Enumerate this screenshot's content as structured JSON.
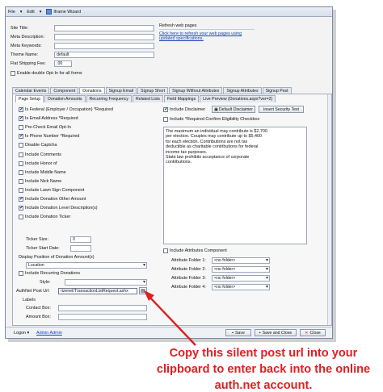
{
  "menu": {
    "file": "File",
    "edit": "Edit",
    "wizard": "Iframe Wizard"
  },
  "site": {
    "site_title_label": "Site Title:",
    "meta_description_label": "Meta Description:",
    "meta_keywords_label": "Meta Keywords:",
    "theme_name_label": "Theme Name:",
    "theme_name_value": "default",
    "flat_shipping_label": "Flat Shipping Fee:",
    "flat_shipping_value": ".00",
    "double_optin_label": "Enable double Opt-In for all forms"
  },
  "refresh": {
    "title": "Refresh web pages",
    "link_line1": "Click here to refresh your web pages using",
    "link_line2": "updated specifications."
  },
  "tabs": [
    "Calendar Events",
    "Component",
    "Donations",
    "Signup Email",
    "Signup Short",
    "Signup Without Attributes",
    "Signup Attributes",
    "Signup Post"
  ],
  "subtabs": [
    "Page Setup",
    "Donation Amounts",
    "Recurring Frequency",
    "Related Lists",
    "Field Mappings",
    "Live Preview (Donations.aspx?ver=2)"
  ],
  "left_options": [
    {
      "label": "Is Federal (Employer / Occupation) *Required",
      "checked": true
    },
    {
      "label": "Is Email Address *Required",
      "checked": true
    },
    {
      "label": "Pre-Check Email Opt-In",
      "checked": false
    },
    {
      "label": "Is Phone Number *Required",
      "checked": true
    },
    {
      "label": "Disable Captcha",
      "checked": false
    },
    {
      "label": "Include Comments",
      "checked": false
    },
    {
      "label": "Include Honor of",
      "checked": false
    },
    {
      "label": "Include Middle Name",
      "checked": false
    },
    {
      "label": "Include Nick Name",
      "checked": false
    },
    {
      "label": "Include Lawn Sign Component",
      "checked": false
    },
    {
      "label": "Include Donation Other Amount",
      "checked": true
    },
    {
      "label": "Include Donation Level Description(s)",
      "checked": true
    },
    {
      "label": "Include Donation Ticker",
      "checked": false
    }
  ],
  "ticker": {
    "size_label": "Ticker Size:",
    "size_value": "0",
    "start_label": "Ticker Start Date:"
  },
  "position": {
    "label": "Display Position of Donation Amount(s)",
    "value": "Location",
    "recurring_label": "Include Recurring Donations",
    "style_label": "Style:",
    "authnet_label": "AuthNet Post Url:",
    "authnet_value": "rizenet/TransactionListRequest.ashx",
    "labels_title": "Labels",
    "contact_box_label": "Contact Box:",
    "amount_box_label": "Amount Box:"
  },
  "right_options": {
    "include_disclaimer": "Include Disclaimer",
    "default_disclaimer_btn": "Default Disclaimer",
    "insert_security_btn": "Insert Security Text",
    "confirm_eligibility": "Include *Required Confirm Eligibility Checkbox",
    "disclaimer_text": "The maximum an individual may contribute is $2,700\nper election. Couples may contribute up to $5,400\nfor each election. Contributions are not tax\ndeductible as charitable contributions for federal\nincome tax purposes.\nState law prohibits acceptance of corporate\ncontributions.",
    "include_attr_component": "Include Attributes Component",
    "attr_folders": [
      {
        "label": "Attribute Folder 1:",
        "value": "<no folder>"
      },
      {
        "label": "Attribute Folder 2:",
        "value": "<no folder>"
      },
      {
        "label": "Attribute Folder 3:",
        "value": "<no folder>"
      },
      {
        "label": "Attribute Folder 4:",
        "value": "<no folder>"
      }
    ]
  },
  "status": {
    "logon_label": "Logon",
    "user_link": "Admin Admin",
    "save_btn": "Save",
    "save_close_btn": "Save and Close",
    "close_btn": "Close"
  },
  "caption": "Copy this silent post url into your clipboard to enter back into the online auth.net account.",
  "colors": {
    "caption": "#e11f1f",
    "link": "#1a44b8"
  }
}
